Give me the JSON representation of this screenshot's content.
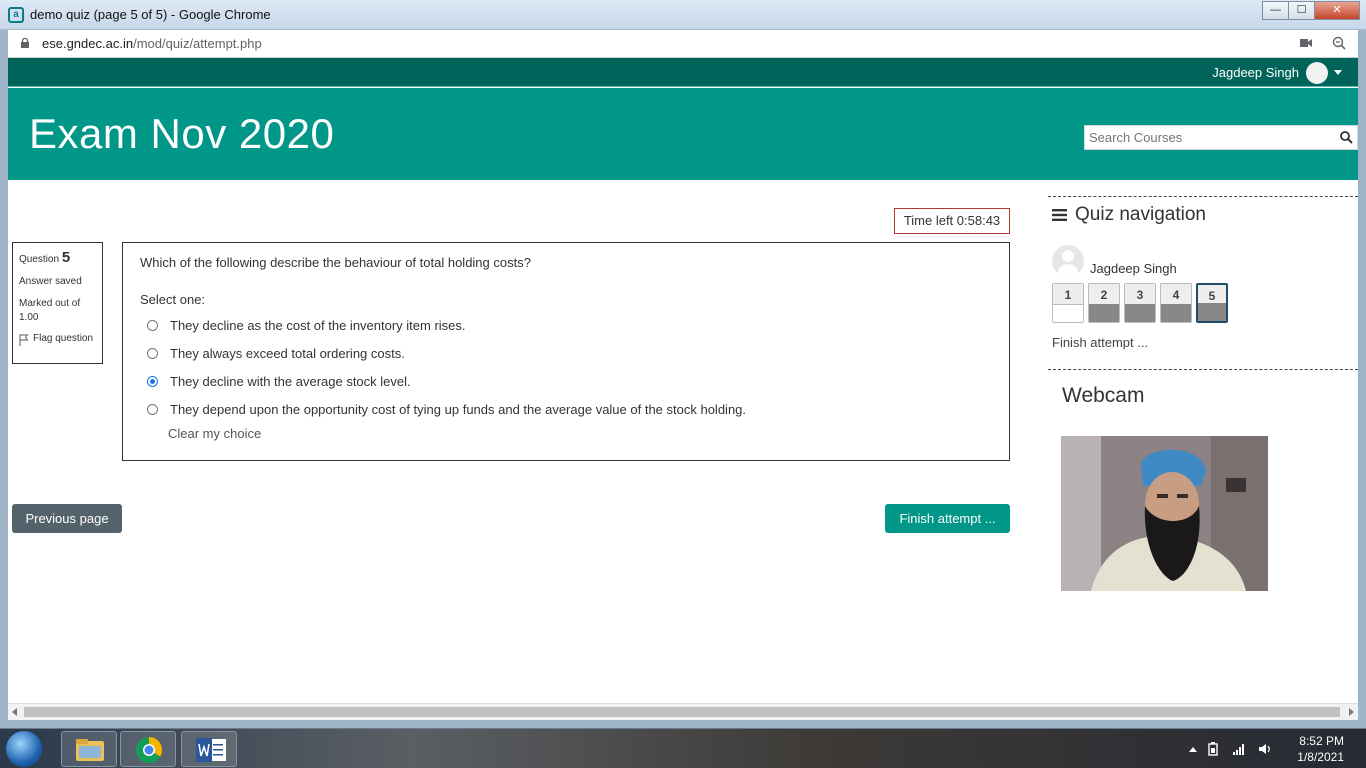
{
  "window": {
    "title": "demo quiz (page 5 of 5) - Google Chrome",
    "minimize_label": "—",
    "maximize_label": "☐",
    "close_label": "✕"
  },
  "address": {
    "domain": "ese.gndec.ac.in",
    "path": "/mod/quiz/attempt.php"
  },
  "topbar": {
    "user_name": "Jagdeep Singh"
  },
  "header": {
    "course_title": "Exam Nov 2020",
    "search_placeholder": "Search Courses"
  },
  "quiz": {
    "time_left": "Time left 0:58:43",
    "info": {
      "question_label": "Question",
      "question_number": "5",
      "status": "Answer saved",
      "marked_out_of": "Marked out of 1.00",
      "flag_label": "Flag question"
    },
    "question_text": "Which of the following describe the behaviour of total holding costs?",
    "select_one": "Select one:",
    "options": [
      {
        "label": "They decline as the cost of the inventory item rises.",
        "checked": false
      },
      {
        "label": "They always exceed total ordering costs.",
        "checked": false
      },
      {
        "label": "They decline with the average stock level.",
        "checked": true
      },
      {
        "label": "They depend upon the opportunity cost of tying up funds and the average value of the stock holding.",
        "checked": false
      }
    ],
    "clear_choice": "Clear my choice",
    "previous_button": "Previous page",
    "finish_button": "Finish attempt ..."
  },
  "navigation": {
    "title": "Quiz navigation",
    "user_name": "Jagdeep Singh",
    "questions": [
      {
        "number": "1",
        "state": "notyet"
      },
      {
        "number": "2",
        "state": "answered"
      },
      {
        "number": "3",
        "state": "answered"
      },
      {
        "number": "4",
        "state": "answered"
      },
      {
        "number": "5",
        "state": "answered-current"
      }
    ],
    "finish_link": "Finish attempt ..."
  },
  "webcam": {
    "title": "Webcam"
  },
  "taskbar": {
    "time": "8:52 PM",
    "date": "1/8/2021"
  },
  "colors": {
    "topbar": "#00645a",
    "header": "#009688",
    "finish_button": "#009688",
    "previous_button": "#54636b",
    "timer_border": "#b13c33"
  }
}
